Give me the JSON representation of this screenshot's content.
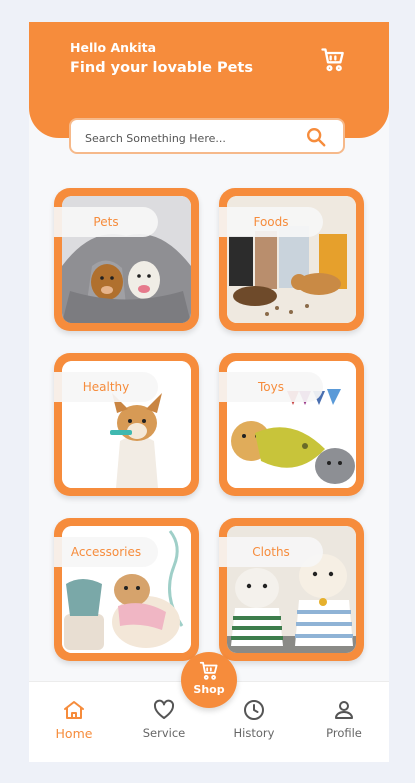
{
  "header": {
    "greeting": "Hello Ankita",
    "tagline": "Find your lovable Pets",
    "cart_icon": "cart-icon"
  },
  "search": {
    "placeholder": "Search Something Here...",
    "icon": "search-icon"
  },
  "categories": [
    {
      "label": "Pets"
    },
    {
      "label": "Foods"
    },
    {
      "label": "Healthy"
    },
    {
      "label": "Toys"
    },
    {
      "label": "Accessories"
    },
    {
      "label": "Cloths"
    }
  ],
  "fab": {
    "label": "Shop",
    "icon": "cart-icon"
  },
  "nav": {
    "items": [
      {
        "label": "Home",
        "icon": "home-icon",
        "active": true
      },
      {
        "label": "Service",
        "icon": "heart-icon",
        "active": false
      },
      {
        "label": "History",
        "icon": "clock-icon",
        "active": false
      },
      {
        "label": "Profile",
        "icon": "user-icon",
        "active": false
      }
    ]
  },
  "colors": {
    "accent": "#f68c3c",
    "search_border": "#f6b98a",
    "background": "#f7f8fa"
  }
}
